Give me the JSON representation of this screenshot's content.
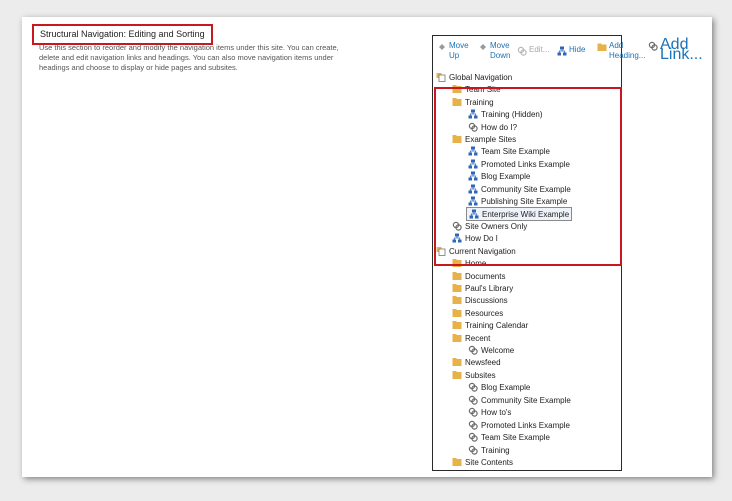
{
  "section": {
    "title": "Structural Navigation: Editing and Sorting",
    "description": "Use this section to reorder and modify the navigation items under this site. You can create, delete and edit navigation links and headings. You can also move navigation items under headings and choose to display or hide pages and subsites."
  },
  "toolbar": {
    "move_up": [
      "Move",
      "Up"
    ],
    "move_down": [
      "Move",
      "Down"
    ],
    "edit": "Edit...",
    "hide": "Hide",
    "add_heading": [
      "Add",
      "Heading..."
    ],
    "add_link": [
      "Add",
      "Link..."
    ]
  },
  "tree": {
    "global": {
      "label": "Global Navigation",
      "items": [
        {
          "label": "Team Site",
          "icon": "folder-icon"
        },
        {
          "label": "Training",
          "icon": "folder-icon"
        },
        {
          "label": "Training (Hidden)",
          "icon": "page-link-icon"
        },
        {
          "label": "How do I?",
          "icon": "link-icon"
        },
        {
          "label": "Example Sites",
          "icon": "folder-icon"
        },
        {
          "label": "Team Site Example",
          "icon": "page-link-icon"
        },
        {
          "label": "Promoted Links Example",
          "icon": "page-link-icon"
        },
        {
          "label": "Blog Example",
          "icon": "page-link-icon"
        },
        {
          "label": "Community Site Example",
          "icon": "page-link-icon"
        },
        {
          "label": "Publishing Site Example",
          "icon": "page-link-icon"
        },
        {
          "label": "Enterprise Wiki Example",
          "icon": "page-link-icon"
        },
        {
          "label": "Site Owners Only",
          "icon": "link-icon"
        },
        {
          "label": "How Do I",
          "icon": "page-link-icon"
        }
      ]
    },
    "current": {
      "label": "Current Navigation",
      "items": [
        {
          "label": "Home",
          "icon": "folder-icon"
        },
        {
          "label": "Documents",
          "icon": "folder-icon"
        },
        {
          "label": "Paul's Library",
          "icon": "folder-icon"
        },
        {
          "label": "Discussions",
          "icon": "folder-icon"
        },
        {
          "label": "Resources",
          "icon": "folder-icon"
        },
        {
          "label": "Training Calendar",
          "icon": "folder-icon"
        },
        {
          "label": "Recent",
          "icon": "folder-icon"
        },
        {
          "label": "Welcome",
          "icon": "link-icon"
        },
        {
          "label": "Newsfeed",
          "icon": "folder-icon"
        },
        {
          "label": "Subsites",
          "icon": "folder-icon"
        },
        {
          "label": "Blog Example",
          "icon": "link-icon"
        },
        {
          "label": "Community Site Example",
          "icon": "link-icon"
        },
        {
          "label": "How to's",
          "icon": "link-icon"
        },
        {
          "label": "Promoted Links Example",
          "icon": "link-icon"
        },
        {
          "label": "Team Site Example",
          "icon": "link-icon"
        },
        {
          "label": "Training",
          "icon": "link-icon"
        },
        {
          "label": "Site Contents",
          "icon": "folder-icon"
        }
      ]
    }
  },
  "colors": {
    "highlight": "#c8171f",
    "link": "#1a73b8",
    "folder": "#e8b24a",
    "page_link": "#2f67b8"
  }
}
